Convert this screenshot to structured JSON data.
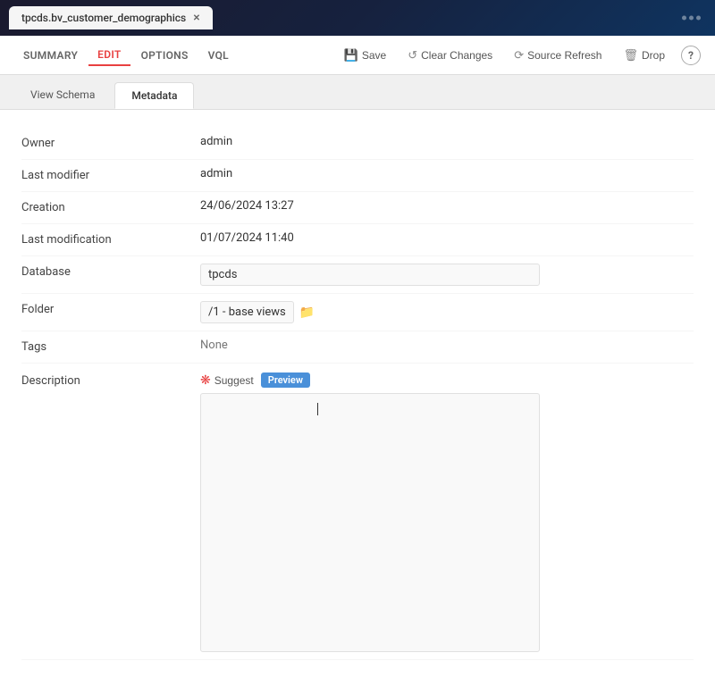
{
  "titleBar": {
    "tabName": "tpcds.bv_customer_demographics",
    "closeIcon": "×"
  },
  "navBar": {
    "tabs": [
      {
        "label": "SUMMARY",
        "active": false
      },
      {
        "label": "EDIT",
        "active": true
      },
      {
        "label": "OPTIONS",
        "active": false
      },
      {
        "label": "VQL",
        "active": false
      }
    ],
    "actions": {
      "save": "Save",
      "clearChanges": "Clear Changes",
      "sourceRefresh": "Source Refresh",
      "drop": "Drop",
      "help": "?"
    }
  },
  "contentTabs": [
    {
      "label": "View Schema",
      "active": false
    },
    {
      "label": "Metadata",
      "active": true
    }
  ],
  "metadata": {
    "rows": [
      {
        "label": "Owner",
        "value": "admin",
        "type": "text"
      },
      {
        "label": "Last modifier",
        "value": "admin",
        "type": "text"
      },
      {
        "label": "Creation",
        "value": "24/06/2024 13:27",
        "type": "text"
      },
      {
        "label": "Last modification",
        "value": "01/07/2024 11:40",
        "type": "text"
      },
      {
        "label": "Database",
        "value": "tpcds",
        "type": "input"
      },
      {
        "label": "Folder",
        "value": "/1 - base views",
        "type": "folder"
      },
      {
        "label": "Tags",
        "value": "None",
        "type": "tags"
      },
      {
        "label": "Description",
        "value": "",
        "type": "description"
      }
    ],
    "suggestLabel": "Suggest",
    "previewLabel": "Preview"
  }
}
